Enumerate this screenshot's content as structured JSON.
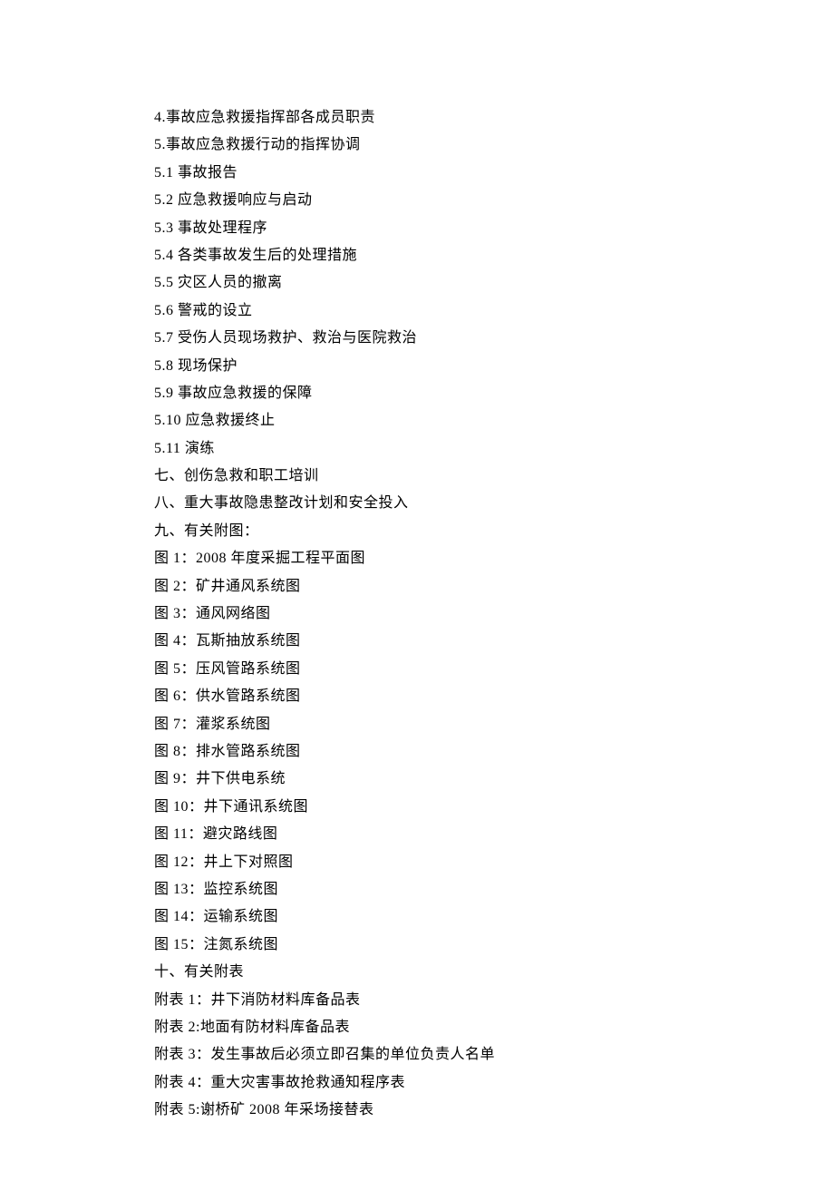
{
  "lines": [
    "4.事故应急救援指挥部各成员职责",
    "5.事故应急救援行动的指挥协调",
    "5.1 事故报告",
    "5.2 应急救援响应与启动",
    "5.3 事故处理程序",
    "5.4 各类事故发生后的处理措施",
    "5.5 灾区人员的撤离",
    "5.6 警戒的设立",
    "5.7 受伤人员现场救护、救治与医院救治",
    "5.8 现场保护",
    "5.9 事故应急救援的保障",
    "5.10 应急救援终止",
    "5.11 演练",
    "七、创伤急救和职工培训",
    "八、重大事故隐患整改计划和安全投入",
    "九、有关附图：",
    "图 1：2008 年度采掘工程平面图",
    "图 2：矿井通风系统图",
    "图 3：通风网络图",
    "图 4：瓦斯抽放系统图",
    "图 5：压风管路系统图",
    "图 6：供水管路系统图",
    "图 7：灌浆系统图",
    "图 8：排水管路系统图",
    "图 9：井下供电系统",
    "图 10：井下通讯系统图",
    "图 11：避灾路线图",
    "图 12：井上下对照图",
    "图 13：监控系统图",
    "图 14：运输系统图",
    "图 15：注氮系统图",
    "十、有关附表",
    "附表 1：井下消防材料库备品表",
    "附表 2:地面有防材料库备品表",
    "附表 3：发生事故后必须立即召集的单位负责人名单",
    "附表 4：重大灾害事故抢救通知程序表",
    "附表 5:谢桥矿 2008 年采场接替表"
  ]
}
